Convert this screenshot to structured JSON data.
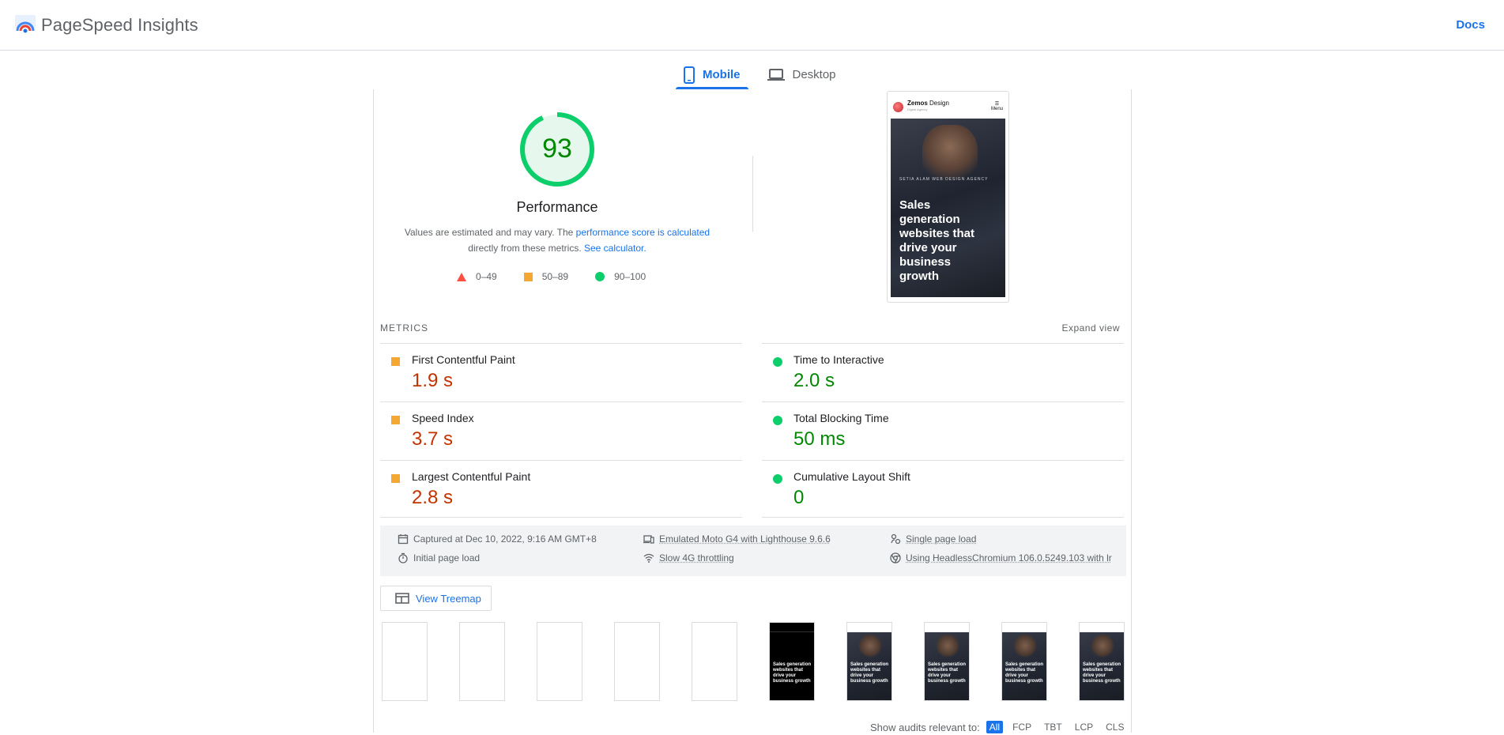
{
  "header": {
    "app_title": "PageSpeed Insights",
    "docs_label": "Docs"
  },
  "tabs": [
    {
      "label": "Mobile",
      "active": true
    },
    {
      "label": "Desktop",
      "active": false
    }
  ],
  "performance": {
    "score": "93",
    "score_value": 93,
    "label": "Performance",
    "desc_prefix": "Values are estimated and may vary. The ",
    "desc_link": "performance score is calculated",
    "desc_mid": "directly from these metrics. ",
    "desc_link2": "See calculator.",
    "legend": [
      {
        "range": "0–49",
        "shape": "triangle",
        "color": "#ff4e42"
      },
      {
        "range": "50–89",
        "shape": "square",
        "color": "#f4a732"
      },
      {
        "range": "90–100",
        "shape": "circle",
        "color": "#0cce6b"
      }
    ]
  },
  "screenshot": {
    "brand": "Zemos",
    "brand_rest": " Design",
    "brand_sub": "Digital Agency",
    "menu_label": "Menu",
    "kicker": "SETIA ALAM WEB DESIGN AGENCY",
    "headline": "Sales generation websites that drive your business growth"
  },
  "metrics": {
    "title": "METRICS",
    "expand_label": "Expand view",
    "left": [
      {
        "label": "First Contentful Paint",
        "value": "1.9 s",
        "status": "average"
      },
      {
        "label": "Speed Index",
        "value": "3.7 s",
        "status": "average"
      },
      {
        "label": "Largest Contentful Paint",
        "value": "2.8 s",
        "status": "average"
      }
    ],
    "right": [
      {
        "label": "Time to Interactive",
        "value": "2.0 s",
        "status": "pass"
      },
      {
        "label": "Total Blocking Time",
        "value": "50 ms",
        "status": "pass"
      },
      {
        "label": "Cumulative Layout Shift",
        "value": "0",
        "status": "pass"
      }
    ]
  },
  "runtime": {
    "captured": "Captured at Dec 10, 2022, 9:16 AM GMT+8",
    "initial_load": "Initial page load",
    "device": "Emulated Moto G4 with Lighthouse 9.6.6",
    "throttling": "Slow 4G throttling",
    "session": "Single page load",
    "browser": "Using HeadlessChromium 106.0.5249.103 with lr"
  },
  "treemap_label": "View Treemap",
  "filmstrip_text": "Sales generation websites that drive your business growth",
  "audit_filter": {
    "label": "Show audits relevant to:",
    "chips": [
      "All",
      "FCP",
      "TBT",
      "LCP",
      "CLS"
    ]
  },
  "colors": {
    "accent": "#1a73e8",
    "pass": "#0cce6b",
    "average": "#f4a732",
    "fail": "#ff4e42",
    "pass_text": "#008800",
    "average_text": "#c33300"
  }
}
